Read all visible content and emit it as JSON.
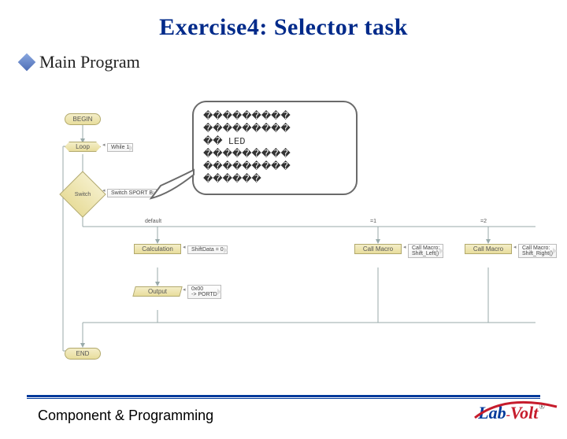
{
  "title": "Exercise4: Selector task",
  "subtitle": "Main Program",
  "callout": {
    "line1": "���������",
    "line2": "���������",
    "line3": "�� LED",
    "line4": "���������",
    "line5": "���������",
    "line6": "������"
  },
  "flow": {
    "begin": "BEGIN",
    "loop": "Loop",
    "while": "While\n1",
    "switch": "Switch",
    "switch_cond": "Switch SPORT B",
    "branch_default": "default",
    "branch_eq1": "=1",
    "branch_eq2": "=2",
    "calc_title": "Calculation",
    "calc_body": "ShiftData = 0",
    "out_title": "Output",
    "out_body": "0x00\n-> PORTD",
    "call_title": "Call Macro",
    "call_left": "Call Macro:\nShift_Left()",
    "call_right": "Call Macro:\nShift_Right()",
    "end": "END"
  },
  "footer": "Component & Programming",
  "logo": {
    "lab": "Lab",
    "dash": "-",
    "volt": "Volt",
    "r": "®"
  }
}
